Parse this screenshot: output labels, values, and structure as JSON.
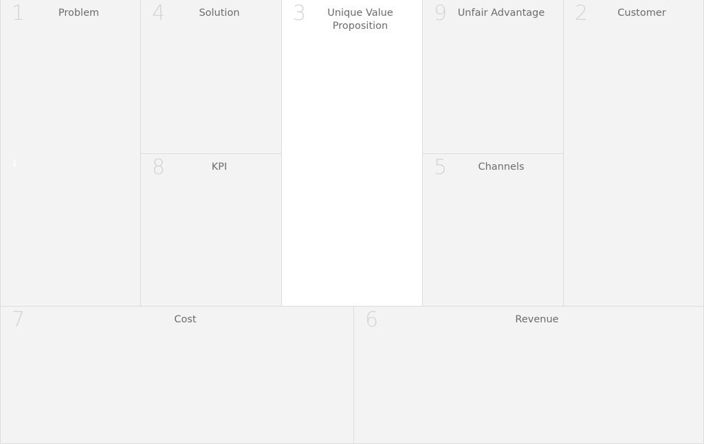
{
  "canvas": {
    "problem": {
      "number": "1",
      "title": "Problem",
      "extra_mark": "1"
    },
    "solution": {
      "number": "4",
      "title": "Solution"
    },
    "kpi": {
      "number": "8",
      "title": "KPI"
    },
    "uvp": {
      "number": "3",
      "title": "Unique Value\nProposition"
    },
    "unfair": {
      "number": "9",
      "title": "Unfair Advantage"
    },
    "channels": {
      "number": "5",
      "title": "Channels"
    },
    "customer": {
      "number": "2",
      "title": "Customer"
    },
    "cost": {
      "number": "7",
      "title": "Cost"
    },
    "revenue": {
      "number": "6",
      "title": "Revenue"
    }
  },
  "colors": {
    "background": "#f3f3f3",
    "highlight_cell": "#ffffff",
    "border": "#dcdcdc",
    "number": "#d3d3d3",
    "title": "#6b6b6b"
  }
}
